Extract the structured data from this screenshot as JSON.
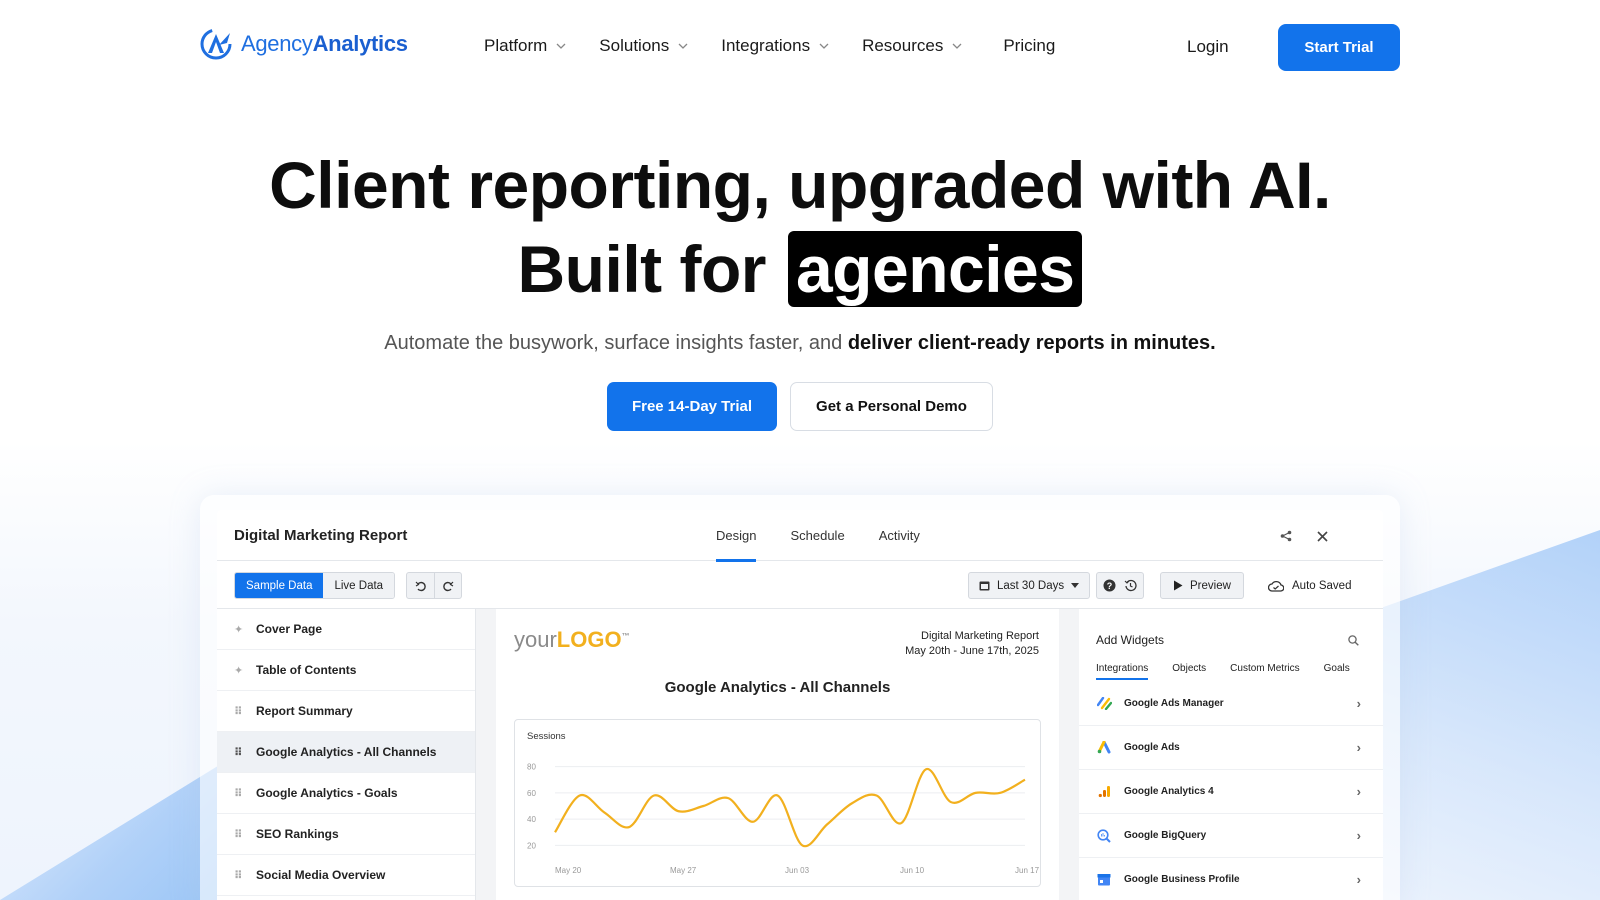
{
  "brand": {
    "name_light": "Agency",
    "name_bold": "Analytics"
  },
  "nav": {
    "items": [
      {
        "label": "Platform",
        "has_dropdown": true
      },
      {
        "label": "Solutions",
        "has_dropdown": true
      },
      {
        "label": "Integrations",
        "has_dropdown": true
      },
      {
        "label": "Resources",
        "has_dropdown": true
      },
      {
        "label": "Pricing",
        "has_dropdown": false
      }
    ],
    "login": "Login",
    "cta": "Start Trial"
  },
  "hero": {
    "line1": "Client reporting, upgraded with AI.",
    "line2_prefix": "Built for",
    "line2_highlight": "agencies",
    "subtitle_plain": "Automate the busywork, surface insights faster, and ",
    "subtitle_bold": "deliver client-ready reports in minutes.",
    "primary_button": "Free 14-Day Trial",
    "secondary_button": "Get a Personal Demo"
  },
  "app": {
    "title": "Digital Marketing Report",
    "tabs": [
      {
        "label": "Design",
        "active": true
      },
      {
        "label": "Schedule",
        "active": false
      },
      {
        "label": "Activity",
        "active": false
      }
    ],
    "toolbar": {
      "sample_data": "Sample Data",
      "live_data": "Live Data",
      "date_range": "Last 30 Days",
      "preview": "Preview",
      "auto_saved": "Auto Saved"
    },
    "sidebar": [
      {
        "label": "Cover Page",
        "icon": "pin-icon",
        "selected": false
      },
      {
        "label": "Table of Contents",
        "icon": "pin-icon",
        "selected": false
      },
      {
        "label": "Report Summary",
        "icon": "drag-handle-icon",
        "selected": false
      },
      {
        "label": "Google Analytics - All Channels",
        "icon": "drag-handle-icon",
        "selected": true
      },
      {
        "label": "Google Analytics - Goals",
        "icon": "drag-handle-icon",
        "selected": false
      },
      {
        "label": "SEO Rankings",
        "icon": "drag-handle-icon",
        "selected": false
      },
      {
        "label": "Social Media Overview",
        "icon": "drag-handle-icon",
        "selected": false
      }
    ],
    "report": {
      "logo_your": "your",
      "logo_logo": "LOGO",
      "logo_tm": "™",
      "meta_title": "Digital Marketing Report",
      "meta_dates": "May 20th - June 17th, 2025",
      "section_title": "Google Analytics - All Channels"
    },
    "widgets": {
      "title": "Add Widgets",
      "tabs": [
        {
          "label": "Integrations",
          "active": true
        },
        {
          "label": "Objects",
          "active": false
        },
        {
          "label": "Custom Metrics",
          "active": false
        },
        {
          "label": "Goals",
          "active": false
        }
      ],
      "items": [
        {
          "label": "Google Ads Manager",
          "icon": "google-ads-manager-icon"
        },
        {
          "label": "Google Ads",
          "icon": "google-ads-icon"
        },
        {
          "label": "Google Analytics 4",
          "icon": "google-analytics-icon"
        },
        {
          "label": "Google BigQuery",
          "icon": "bigquery-icon"
        },
        {
          "label": "Google Business Profile",
          "icon": "business-profile-icon"
        }
      ]
    }
  },
  "colors": {
    "accent": "#1273eb",
    "line": "#f2b01e",
    "logo_yellow": "#f2b01e"
  },
  "chart_data": {
    "type": "line",
    "title": "",
    "ylabel": "Sessions",
    "xlabel": "",
    "yticks": [
      80,
      60,
      40,
      20
    ],
    "ylim": [
      15,
      85
    ],
    "xticks": [
      "May 20",
      "May 27",
      "Jun 03",
      "Jun 10",
      "Jun 17"
    ],
    "series": [
      {
        "values": [
          30,
          58,
          45,
          34,
          58,
          46,
          50,
          56,
          38,
          58,
          20,
          36,
          52,
          58,
          37,
          78,
          53,
          60,
          60,
          70
        ]
      }
    ],
    "grid": true
  }
}
